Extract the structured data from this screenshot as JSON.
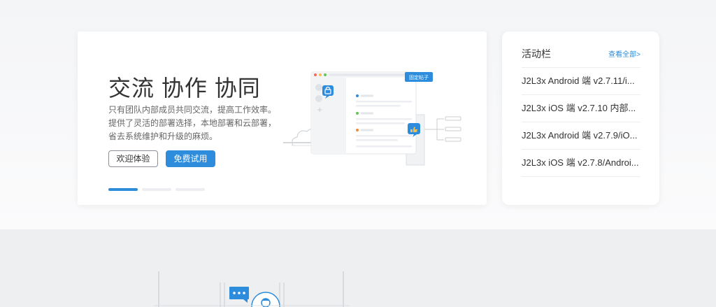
{
  "hero": {
    "title": "交流 协作 协同",
    "description": "只有团队内部成员共同交流，提高工作效率。 提供了灵活的部署选择，本地部署和云部署， 省去系统维护和升级的麻烦。",
    "button_experience": "欢迎体验",
    "button_trial": "免费试用",
    "carousel_total": 3,
    "carousel_active": 1,
    "illustration_badge": "固定帖子"
  },
  "activity": {
    "title": "活动栏",
    "view_all": "查看全部>",
    "items": [
      "J2L3x Android 端 v2.7.11/i...",
      "J2L3x iOS 端 v2.7.10 内部...",
      "J2L3x Android 端 v2.7.9/iO...",
      "J2L3x iOS 端 v2.7.8/Androi..."
    ]
  },
  "colors": {
    "accent": "#2d8cdb",
    "text": "#333333",
    "muted": "#666666",
    "page_bg": "#f4f5f7",
    "lower_bg": "#eeeff1"
  },
  "icons": [
    "lock-icon",
    "thumbs-up-icon",
    "chat-bubble-icon",
    "cloud-icon",
    "user-avatar-icon"
  ]
}
